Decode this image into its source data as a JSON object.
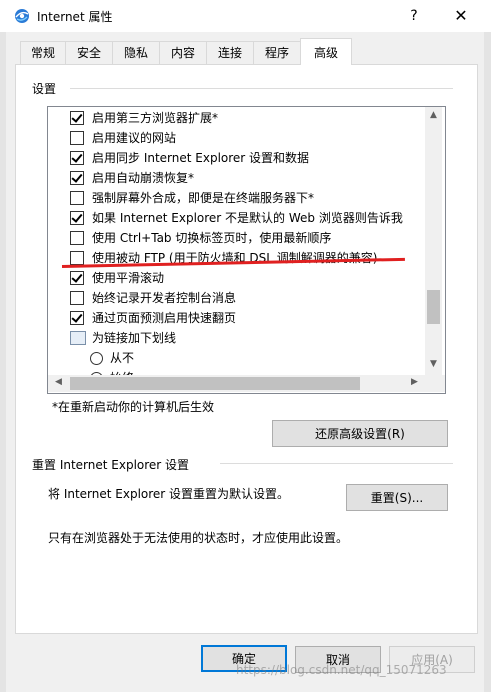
{
  "window": {
    "title": "Internet 属性",
    "help_glyph": "?",
    "close_glyph": "✕"
  },
  "tabs": [
    "常规",
    "安全",
    "隐私",
    "内容",
    "连接",
    "程序",
    "高级"
  ],
  "active_tab": "高级",
  "settings_group": {
    "label": "设置",
    "items": [
      {
        "type": "checkbox",
        "checked": true,
        "label": "启用第三方浏览器扩展*"
      },
      {
        "type": "checkbox",
        "checked": false,
        "label": "启用建议的网站"
      },
      {
        "type": "checkbox",
        "checked": true,
        "label": "启用同步 Internet Explorer 设置和数据"
      },
      {
        "type": "checkbox",
        "checked": true,
        "label": "启用自动崩溃恢复*"
      },
      {
        "type": "checkbox",
        "checked": false,
        "label": "强制屏幕外合成，即便是在终端服务器下*"
      },
      {
        "type": "checkbox",
        "checked": true,
        "label": "如果 Internet Explorer 不是默认的 Web 浏览器则告诉我"
      },
      {
        "type": "checkbox",
        "checked": false,
        "label": "使用 Ctrl+Tab 切换标签页时，使用最新顺序"
      },
      {
        "type": "checkbox",
        "checked": false,
        "label": "使用被动 FTP (用于防火墙和 DSL 调制解调器的兼容)"
      },
      {
        "type": "checkbox",
        "checked": true,
        "label": "使用平滑滚动"
      },
      {
        "type": "checkbox",
        "checked": false,
        "label": "始终记录开发者控制台消息"
      },
      {
        "type": "checkbox",
        "checked": true,
        "label": "通过页面预测启用快速翻页"
      },
      {
        "type": "folder",
        "label": "为链接加下划线"
      },
      {
        "type": "radio",
        "label": "从不"
      },
      {
        "type": "radio",
        "label": "始终"
      }
    ],
    "restart_note": "*在重新启动你的计算机后生效",
    "restore_button": "还原高级设置(R)"
  },
  "reset_group": {
    "label": "重置 Internet Explorer 设置",
    "description": "将 Internet Explorer 设置重置为默认设置。",
    "reset_button": "重置(S)...",
    "note": "只有在浏览器处于无法使用的状态时，才应使用此设置。"
  },
  "footer": {
    "ok": "确定",
    "cancel": "取消",
    "apply": "应用(A)"
  },
  "watermark": "https://blog.csdn.net/qq_15071263",
  "colors": {
    "highlight_line": "#e02020",
    "default_button_border": "#0078d7"
  }
}
